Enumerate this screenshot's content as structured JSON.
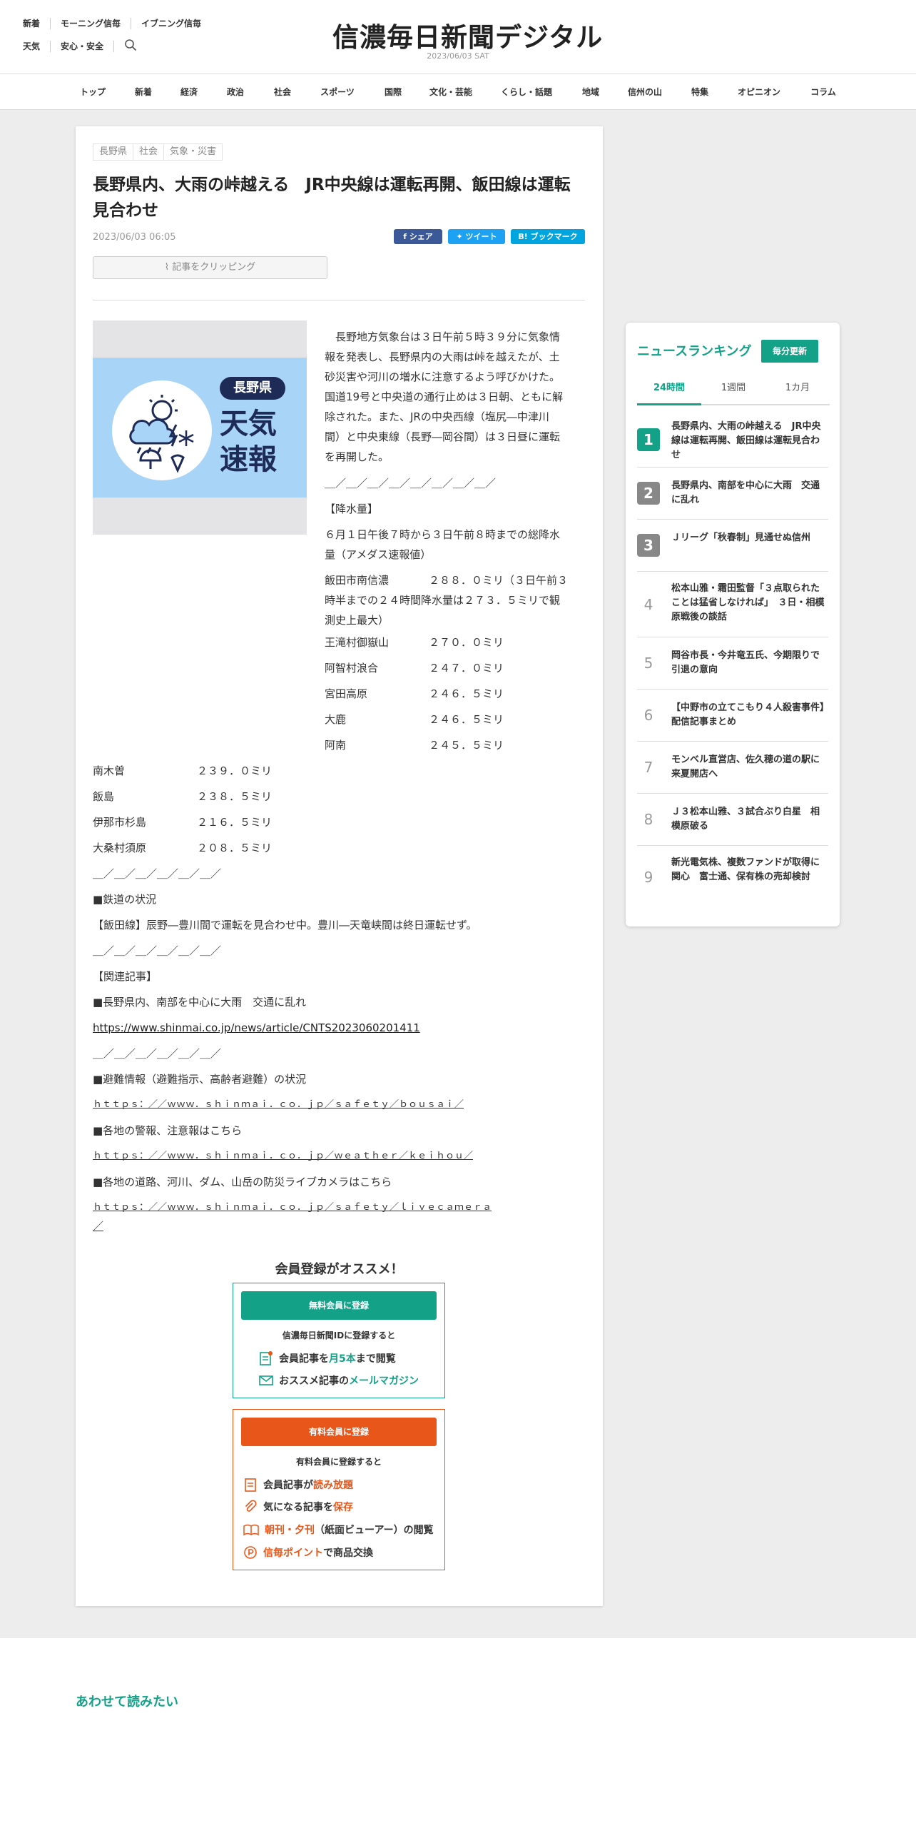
{
  "header": {
    "links_row1": [
      "新着",
      "モーニング信毎",
      "イブニング信毎"
    ],
    "links_row2": [
      "天気",
      "安心・安全"
    ],
    "logo": "信濃毎日新聞デジタル",
    "date": "2023/06/03 SAT"
  },
  "nav": [
    "トップ",
    "新着",
    "経済",
    "政治",
    "社会",
    "スポーツ",
    "国際",
    "文化・芸能",
    "くらし・話題",
    "地域",
    "信州の山",
    "特集",
    "オピニオン",
    "コラム"
  ],
  "article": {
    "tags": [
      "長野県",
      "社会",
      "気象・災害"
    ],
    "title": "長野県内、大雨の峠越える　JR中央線は運転再開、飯田線は運転見合わせ",
    "date": "2023/06/03 06:05",
    "share": "シェア",
    "tweet": "ツイート",
    "bookmark": "ブックマーク",
    "clip": "記事をクリッピング",
    "image": {
      "pill": "長野県",
      "line1": "天気",
      "line2": "速報"
    },
    "lead": [
      "　長野地方気象台は３日午前５時３９分に気象情",
      "報を発表し、長野県内の大雨は峠を越えたが、土",
      "砂災害や河川の増水に注意するよう呼びかけた。",
      "国道19号と中央道の通行止めは３日朝、ともに解",
      "除された。また、JRの中央西線（塩尻―中津川",
      "間）と中央東線（長野―岡谷間）は３日昼に運転",
      "を再開した。"
    ],
    "divider": "＿／＿／＿／＿／＿／＿／＿／＿／",
    "rain_header": "【降水量】",
    "rain_desc": [
      "６月１日午後７時から３日午前８時までの総降水",
      "量（アメダス速報値）"
    ],
    "iida": {
      "name": "飯田市南信濃",
      "lines": [
        "２８８．０ミリ（３日午前３",
        "時半までの２４時間降水量は２７３．５ミリで観",
        "測史上最大）"
      ]
    },
    "rain_right": [
      {
        "place": "王滝村御嶽山",
        "value": "２７０．０ミリ"
      },
      {
        "place": "阿智村浪合",
        "value": "２４７．０ミリ"
      },
      {
        "place": "宮田高原",
        "value": "２４６．５ミリ"
      },
      {
        "place": "大鹿",
        "value": "２４６．５ミリ"
      },
      {
        "place": "阿南",
        "value": "２４５．５ミリ"
      }
    ],
    "rain_full": [
      {
        "place": "南木曽",
        "value": "２３９．０ミリ"
      },
      {
        "place": "飯島",
        "value": "２３８．５ミリ"
      },
      {
        "place": "伊那市杉島",
        "value": "２１６．５ミリ"
      },
      {
        "place": "大桑村須原",
        "value": "２０８．５ミリ"
      }
    ],
    "divider2": "＿／＿／＿／＿／＿／＿／",
    "rail_header": "■鉄道の状況",
    "rail_text": "【飯田線】辰野―豊川間で運転を見合わせ中。豊川―天竜峡間は終日運転せず。",
    "related_header": "【関連記事】",
    "related_title": "■長野県内、南部を中心に大雨　交通に乱れ",
    "related_link": "https://www.shinmai.co.jp/news/article/CNTS2023060201411",
    "evac_header": "■避難情報（避難指示、高齢者避難）の状況",
    "evac_link": "ｈｔｔｐｓ：／／ｗｗｗ．ｓｈｉｎｍａｉ．ｃｏ．ｊｐ／ｓａｆｅｔｙ／ｂｏｕｓａｉ／",
    "warn_header": "■各地の警報、注意報はこちら",
    "warn_link": "ｈｔｔｐｓ：／／ｗｗｗ．ｓｈｉｎｍａｉ．ｃｏ．ｊｐ／ｗｅａｔｈｅｒ／ｋｅｉｈｏｕ／",
    "cam_header": "■各地の道路、河川、ダム、山岳の防災ライブカメラはこちら",
    "cam_link1": "ｈｔｔｐｓ：／／ｗｗｗ．ｓｈｉｎｍａｉ．ｃｏ．ｊｐ／ｓａｆｅｔｙ／ｌｉｖｅｃａｍｅｒａ",
    "cam_link2": "／"
  },
  "register": {
    "title": "会員登録がオススメ！",
    "free_button": "無料会員に登録",
    "free_sub": "信濃毎日新聞IDに登録すると",
    "free_line1": {
      "a": "会員記事を",
      "b": "月5本",
      "c": "まで閲覧"
    },
    "free_line2": {
      "a": "おススメ記事の",
      "b": "メールマガジン"
    },
    "paid_button": "有料会員に登録",
    "paid_sub": "有料会員に登録すると",
    "paid_line1": {
      "a": "会員記事が",
      "b": "読み放題"
    },
    "paid_line2": {
      "a": "気になる記事を",
      "b": "保存"
    },
    "paid_line3": {
      "a": "朝刊・夕刊",
      "b": "（紙面ビューアー）の閲覧"
    },
    "paid_line4": {
      "a": "信毎ポイント",
      "b": "で商品交換"
    },
    "colors": {
      "free": "#13a188",
      "paid": "#e8561a"
    }
  },
  "ranking": {
    "title": "ニュースランキング",
    "badge": "毎分更新",
    "tabs": [
      "24時間",
      "1週間",
      "1カ月"
    ],
    "items": [
      {
        "n": "1",
        "text": "長野県内、大雨の峠越える　JR中央線は運転再開、飯田線は運転見合わせ"
      },
      {
        "n": "2",
        "text": "長野県内、南部を中心に大雨　交通に乱れ"
      },
      {
        "n": "3",
        "text": "Ｊリーグ「秋春制」見通せぬ信州"
      },
      {
        "n": "4",
        "text": "松本山雅・霜田監督「３点取られたことは猛省しなければ」　３日・相模原戦後の談話"
      },
      {
        "n": "5",
        "text": "岡谷市長・今井竜五氏、今期限りで引退の意向"
      },
      {
        "n": "6",
        "text": "【中野市の立てこもり４人殺害事件】配信記事まとめ"
      },
      {
        "n": "7",
        "text": "モンベル直営店、佐久穂の道の駅に来夏開店へ"
      },
      {
        "n": "8",
        "text": "Ｊ３松本山雅、３試合ぶり白星　相模原破る"
      },
      {
        "n": "9",
        "text": "新光電気株、複数ファンドが取得に関心　富士通、保有株の売却検討"
      }
    ]
  },
  "footer": {
    "read_more": "あわせて読みたい"
  }
}
